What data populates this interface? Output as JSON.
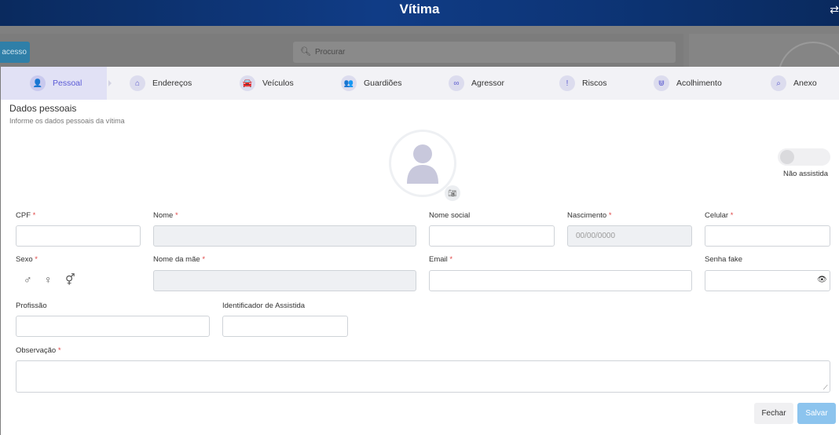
{
  "header": {
    "title": "Vítima"
  },
  "background": {
    "button_label": "acesso",
    "search_placeholder": "Procurar"
  },
  "tabs": [
    {
      "label": "Pessoal",
      "icon": "user-icon",
      "glyph": "👤",
      "active": true
    },
    {
      "label": "Endereços",
      "icon": "home-icon",
      "glyph": "⌂"
    },
    {
      "label": "Veículos",
      "icon": "car-icon",
      "glyph": "🚘"
    },
    {
      "label": "Guardiões",
      "icon": "users-icon",
      "glyph": "👥"
    },
    {
      "label": "Agressor",
      "icon": "glasses-icon",
      "glyph": "∞"
    },
    {
      "label": "Riscos",
      "icon": "alert-icon",
      "glyph": "!"
    },
    {
      "label": "Acolhimento",
      "icon": "hands-icon",
      "glyph": "⋓"
    },
    {
      "label": "Anexo",
      "icon": "paperclip-icon",
      "glyph": "⌕"
    }
  ],
  "section": {
    "title": "Dados pessoais",
    "subtitle": "Informe os dados pessoais da vítima"
  },
  "toggle": {
    "label": "Não assistida",
    "on": false
  },
  "fields": {
    "cpf": {
      "label": "CPF",
      "required": "*",
      "value": ""
    },
    "nome": {
      "label": "Nome",
      "required": "*",
      "value": ""
    },
    "nome_social": {
      "label": "Nome social",
      "value": ""
    },
    "nascimento": {
      "label": "Nascimento",
      "required": "*",
      "placeholder": "00/00/0000"
    },
    "celular": {
      "label": "Celular",
      "required": "*",
      "value": ""
    },
    "sexo": {
      "label": "Sexo",
      "required": "*",
      "options": [
        "♂",
        "♀",
        "⚥"
      ]
    },
    "nome_mae": {
      "label": "Nome da mãe",
      "required": "*",
      "value": ""
    },
    "email": {
      "label": "Email",
      "required": "*",
      "value": ""
    },
    "senha_fake": {
      "label": "Senha fake",
      "value": ""
    },
    "profissao": {
      "label": "Profissão",
      "value": ""
    },
    "identificador": {
      "label": "Identificador de Assistida",
      "value": ""
    },
    "observacao": {
      "label": "Observação",
      "required": "*",
      "value": ""
    }
  },
  "actions": {
    "close_label": "Fechar",
    "save_label": "Salvar"
  },
  "colors": {
    "accent": "#5b5bd6",
    "header": "#103c86",
    "save": "#8cc4ee",
    "required": "#e04747"
  }
}
